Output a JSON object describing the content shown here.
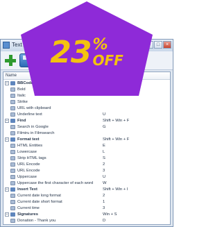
{
  "window": {
    "title": "Text Accelerator"
  },
  "promo": {
    "discount_number": "23",
    "discount_percent": "%",
    "discount_off": "OFF",
    "badge_color": "#8e2ad8",
    "text_color": "#f4c20f"
  },
  "list": {
    "headers": {
      "name": "Name",
      "key": ""
    },
    "rows": [
      {
        "type": "group",
        "name": "BBCode",
        "key": ""
      },
      {
        "type": "item",
        "name": "Bold",
        "key": ""
      },
      {
        "type": "item",
        "name": "Italic",
        "key": ""
      },
      {
        "type": "item",
        "name": "Strike",
        "key": ""
      },
      {
        "type": "item",
        "name": "URL with clipboard",
        "key": ""
      },
      {
        "type": "item",
        "name": "Underline text",
        "key": "U"
      },
      {
        "type": "group",
        "name": "Find",
        "key": "Shift + Win + F"
      },
      {
        "type": "item",
        "name": "Search in Google",
        "key": "G"
      },
      {
        "type": "item",
        "name": "Filmiru in Filmsearch",
        "key": ""
      },
      {
        "type": "group",
        "name": "Format text",
        "key": "Shift + Win + F"
      },
      {
        "type": "item",
        "name": "HTML Entities",
        "key": "E"
      },
      {
        "type": "item",
        "name": "Lowercase",
        "key": "L"
      },
      {
        "type": "item",
        "name": "Strip HTML tags",
        "key": "S"
      },
      {
        "type": "item",
        "name": "URL Encode",
        "key": "2"
      },
      {
        "type": "item",
        "name": "URL Encode",
        "key": "3"
      },
      {
        "type": "item",
        "name": "Uppercase",
        "key": "U"
      },
      {
        "type": "item",
        "name": "Uppercase the first character of each word",
        "key": "W"
      },
      {
        "type": "group",
        "name": "Insert Text",
        "key": "Shift + Win + I"
      },
      {
        "type": "item",
        "name": "Current date long format",
        "key": "2"
      },
      {
        "type": "item",
        "name": "Current date short format",
        "key": "1"
      },
      {
        "type": "item",
        "name": "Current time",
        "key": "3"
      },
      {
        "type": "group",
        "name": "Signatures",
        "key": "Win + S"
      },
      {
        "type": "item",
        "name": "Donation - Thank you",
        "key": "D"
      }
    ]
  }
}
